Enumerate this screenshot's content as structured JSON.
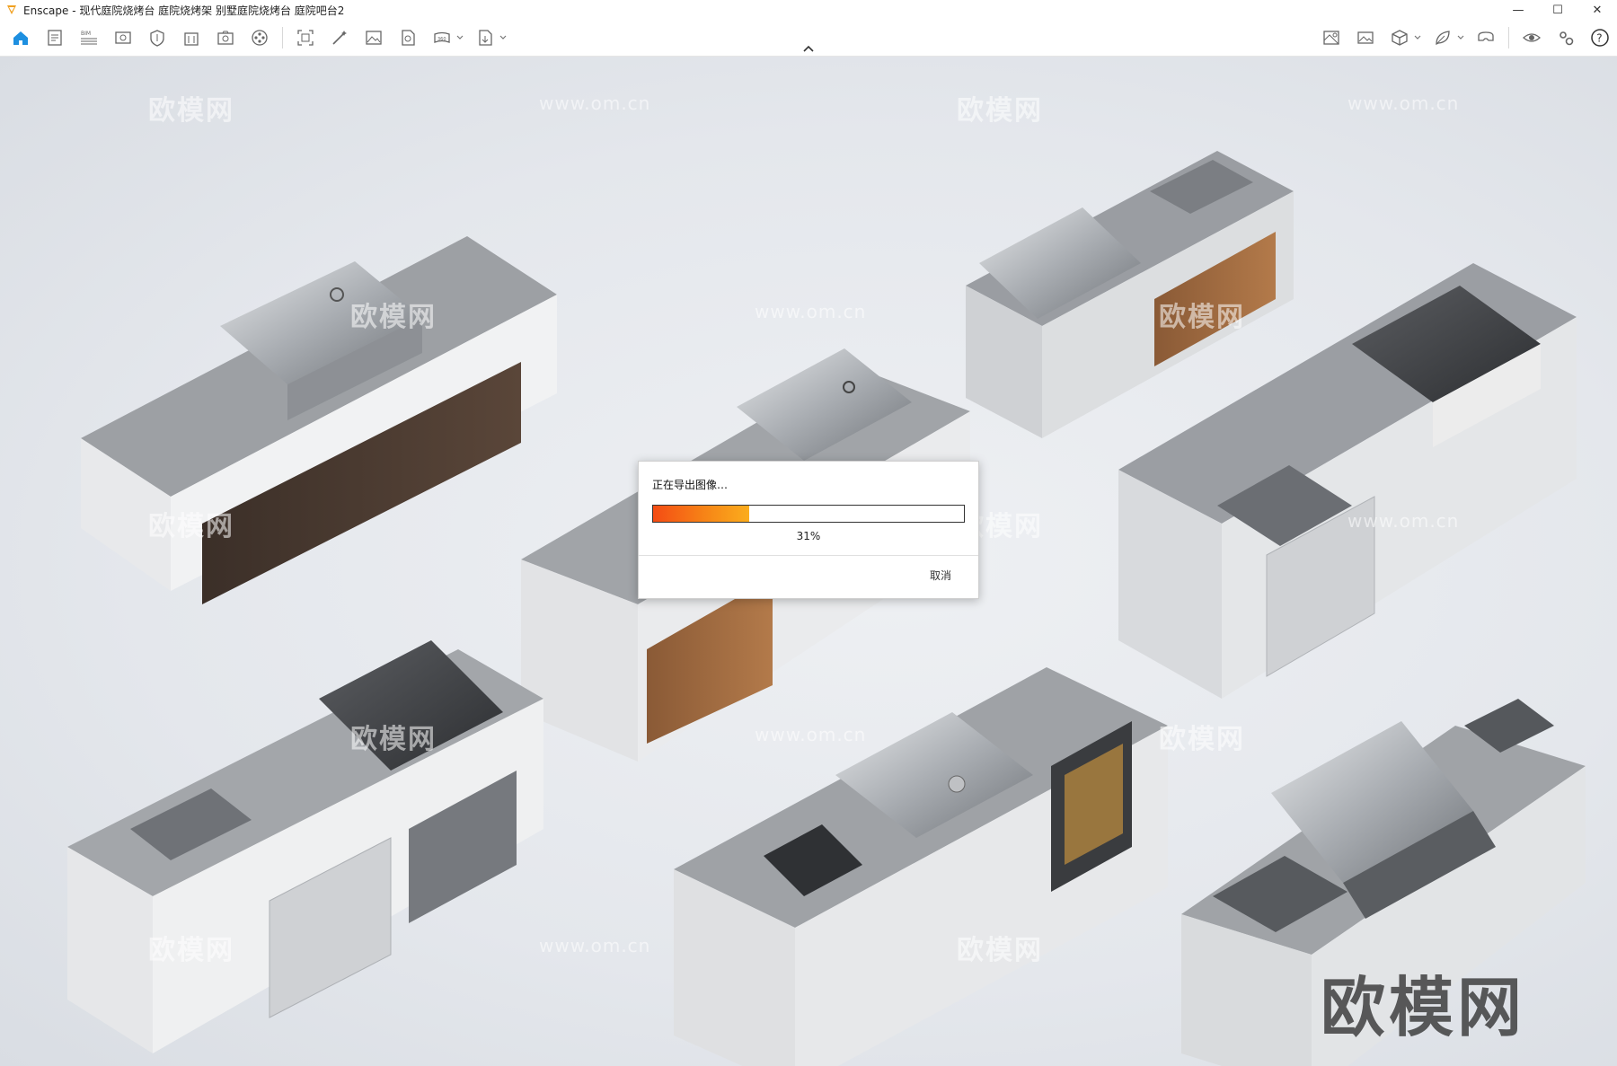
{
  "window": {
    "title": "Enscape - 现代庭院烧烤台 庭院烧烤架 别墅庭院烧烤台 庭院吧台2",
    "controls": {
      "minimize": "—",
      "maximize": "☐",
      "close": "✕"
    }
  },
  "toolbar": {
    "left_tools": [
      "home-icon",
      "document-icon",
      "bim-icon",
      "view-icon",
      "shield-icon",
      "building-icon",
      "add-camera-icon",
      "film-reel-icon"
    ],
    "middle_tools": [
      "screenshot-icon",
      "magic-wand-icon",
      "image-icon",
      "batch-render-icon",
      "panorama-icon",
      "export-icon"
    ],
    "right_tools": [
      "map-icon",
      "gallery-icon",
      "cube-icon",
      "leaf-icon",
      "vr-headset-icon",
      "eye-icon",
      "settings-icon",
      "help-icon"
    ],
    "bim_badge": "BIM"
  },
  "viewport": {
    "watermarks": [
      "欧模网",
      "www.om.cn"
    ],
    "brand_watermark": "欧模网"
  },
  "dialog": {
    "title": "正在导出图像…",
    "progress": 31,
    "progress_label": "31%",
    "cancel_label": "取消"
  },
  "colors": {
    "accent": "#0a84d8",
    "progress_start": "#f44c14",
    "progress_end": "#fbad1d",
    "counter": "#8a8d92",
    "steel": "#b8bbc0"
  }
}
